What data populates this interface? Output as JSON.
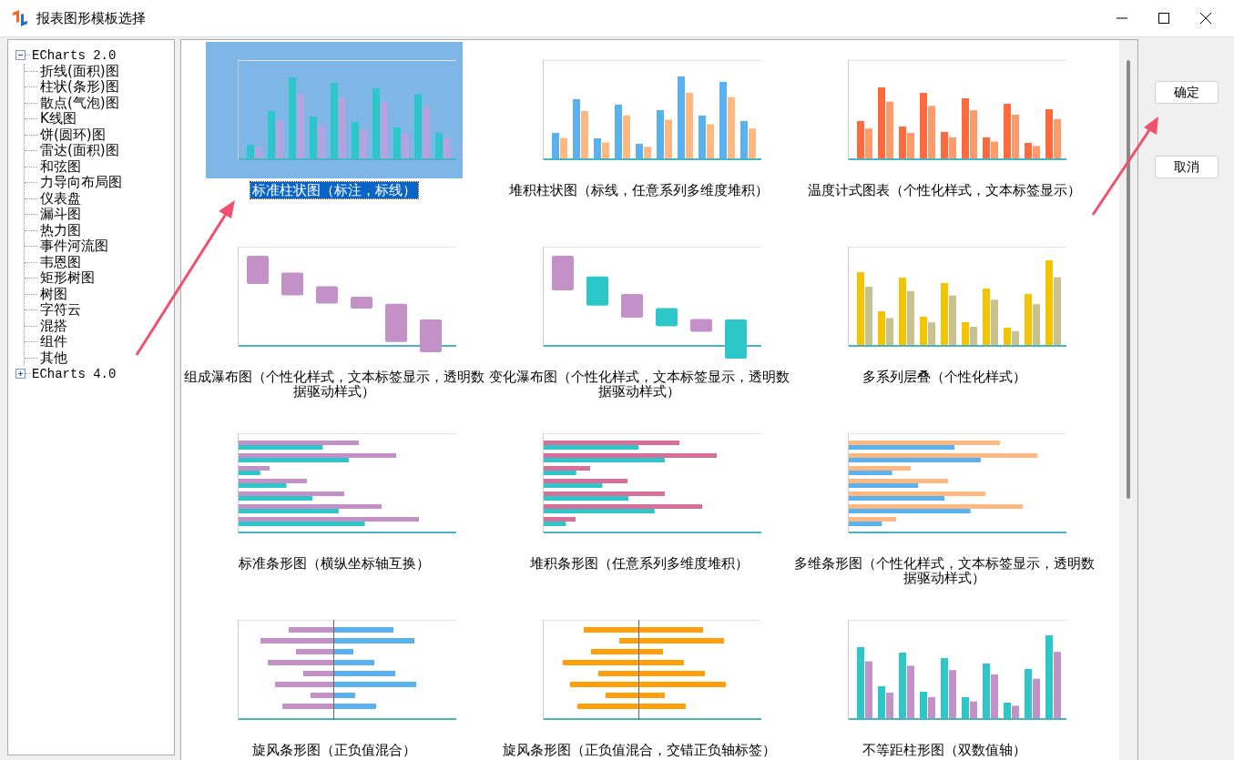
{
  "window": {
    "title": "报表图形模板选择"
  },
  "tree": [
    {
      "label": "ECharts 2.0",
      "expanded": true,
      "children": [
        {
          "label": "折线(面积)图"
        },
        {
          "label": "柱状(条形)图"
        },
        {
          "label": "散点(气泡)图"
        },
        {
          "label": "K线图"
        },
        {
          "label": "饼(圆环)图"
        },
        {
          "label": "雷达(面积)图"
        },
        {
          "label": "和弦图"
        },
        {
          "label": "力导向布局图"
        },
        {
          "label": "仪表盘"
        },
        {
          "label": "漏斗图"
        },
        {
          "label": "热力图"
        },
        {
          "label": "事件河流图"
        },
        {
          "label": "韦恩图"
        },
        {
          "label": "矩形树图"
        },
        {
          "label": "树图"
        },
        {
          "label": "字符云"
        },
        {
          "label": "混搭"
        },
        {
          "label": "组件"
        },
        {
          "label": "其他"
        }
      ]
    },
    {
      "label": "ECharts 4.0",
      "expanded": false
    }
  ],
  "templates": [
    {
      "caption": "标准柱状图（标注，标线）",
      "selected": true,
      "kind": "column"
    },
    {
      "caption": "堆积柱状图（标线，任意系列多维度堆积）",
      "selected": false,
      "kind": "column"
    },
    {
      "caption": "温度计式图表（个性化样式，文本标签显示）",
      "selected": false,
      "kind": "column"
    },
    {
      "caption": "组成瀑布图（个性化样式，文本标签显示，透明数据驱动样式）",
      "selected": false,
      "kind": "waterfall"
    },
    {
      "caption": "变化瀑布图（个性化样式，文本标签显示，透明数据驱动样式）",
      "selected": false,
      "kind": "waterfall"
    },
    {
      "caption": "多系列层叠（个性化样式）",
      "selected": false,
      "kind": "column"
    },
    {
      "caption": "标准条形图（横纵坐标轴互换）",
      "selected": false,
      "kind": "hbar"
    },
    {
      "caption": "堆积条形图（任意系列多维度堆积）",
      "selected": false,
      "kind": "hbar"
    },
    {
      "caption": "多维条形图（个性化样式，文本标签显示，透明数据驱动样式）",
      "selected": false,
      "kind": "hbar"
    },
    {
      "caption": "旋风条形图（正负值混合）",
      "selected": false,
      "kind": "butterfly"
    },
    {
      "caption": "旋风条形图（正负值混合，交错正负轴标签）",
      "selected": false,
      "kind": "butterfly"
    },
    {
      "caption": "不等距柱形图（双数值轴）",
      "selected": false,
      "kind": "column"
    }
  ],
  "buttons": [
    {
      "label": "确定"
    },
    {
      "label": "取消"
    }
  ]
}
